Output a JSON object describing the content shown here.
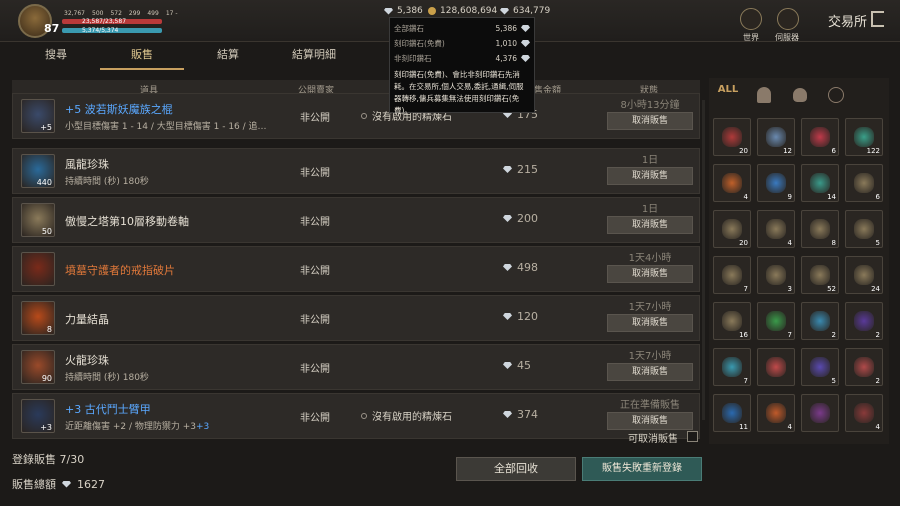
{
  "player": {
    "level": "87",
    "stat_a": "32,767",
    "stat_b": "500",
    "stat_c": "572",
    "stat_d": "299",
    "stat_e": "499",
    "stat_f": "17 -",
    "hp": "23,587/23,587",
    "mp": "5,374/5,374"
  },
  "currency": {
    "gem_free": "5,386",
    "gold": "128,608,694",
    "gem_total": "634,779"
  },
  "nav": {
    "world": "世界",
    "server": "伺服器",
    "title": "交易所"
  },
  "tabs": [
    "搜尋",
    "販售",
    "結算",
    "結算明細"
  ],
  "table": {
    "headers": {
      "item": "道具",
      "public": "公開賣家",
      "price": "售金額",
      "status": "狀態"
    }
  },
  "tooltip": {
    "rows": [
      {
        "label": "全部鑽石",
        "value": "5,386"
      },
      {
        "label": "刻印鑽石(免費)",
        "value": "1,010"
      },
      {
        "label": "非刻印鑽石",
        "value": "4,376"
      }
    ],
    "desc": "刻印鑽石(免費)、會比非刻印鑽石先消耗。在交易所,個人交易,委託,通緝,伺服器轉移,傭兵募集無法使用刻印鑽石(免費)。"
  },
  "rows": [
    {
      "name": "+5 波若斯妖魔族之棍",
      "name_class": "blue",
      "sub": "小型目標傷害 1 - 14 / 大型目標傷害 1 - 16 / 追…",
      "qty": "+5",
      "public": "非公開",
      "refine": "沒有啟用的精煉石",
      "price": "175",
      "status": "8小時13分鐘",
      "cancel": "取消販售",
      "icon_color": "#3a4a6a"
    },
    {
      "name": "風龍珍珠",
      "name_class": "",
      "sub": "持續時間 (秒) 180秒",
      "qty": "440",
      "public": "非公開",
      "refine": "",
      "price": "215",
      "status": "1日",
      "cancel": "取消販售",
      "icon_color": "#2a6a9a"
    },
    {
      "name": "傲慢之塔第10層移動卷軸",
      "name_class": "",
      "sub": "",
      "qty": "50",
      "public": "非公開",
      "refine": "",
      "price": "200",
      "status": "1日",
      "cancel": "取消販售",
      "icon_color": "#8a7a5a"
    },
    {
      "name": "墳墓守護者的戒指破片",
      "name_class": "orange",
      "sub": "",
      "qty": "",
      "public": "非公開",
      "refine": "",
      "price": "498",
      "status": "1天4小時",
      "cancel": "取消販售",
      "icon_color": "#7a2a1a"
    },
    {
      "name": "力量結晶",
      "name_class": "",
      "sub": "",
      "qty": "8",
      "public": "非公開",
      "refine": "",
      "price": "120",
      "status": "1天7小時",
      "cancel": "取消販售",
      "icon_color": "#b84a1a"
    },
    {
      "name": "火龍珍珠",
      "name_class": "",
      "sub": "持續時間 (秒) 180秒",
      "qty": "90",
      "public": "非公開",
      "refine": "",
      "price": "45",
      "status": "1天7小時",
      "cancel": "取消販售",
      "icon_color": "#9a4a2a"
    },
    {
      "name": "+3 古代鬥士臂甲",
      "name_class": "blue",
      "sub_a": "近距離傷害 +2 / 物理防禦力 +3",
      "sub_b": "+3",
      "qty": "+3",
      "public": "非公開",
      "refine": "沒有啟用的精煉石",
      "price": "374",
      "status": "正在準備販售",
      "cancel": "取消販售",
      "icon_color": "#2a3a5a"
    }
  ],
  "inventory": {
    "tabs": [
      "ALL",
      "helmet-icon",
      "bag-icon",
      "ancient-icon"
    ],
    "slots": [
      {
        "q": "20",
        "c": "#b03a3a"
      },
      {
        "q": "12",
        "c": "#6a8ab0"
      },
      {
        "q": "6",
        "c": "#c03a4a"
      },
      {
        "q": "122",
        "c": "#3aa08a"
      },
      {
        "q": "4",
        "c": "#c0602a"
      },
      {
        "q": "9",
        "c": "#3a7ac0"
      },
      {
        "q": "14",
        "c": "#3a9a8a"
      },
      {
        "q": "6",
        "c": "#8a7a5a"
      },
      {
        "q": "20",
        "c": "#8a7a5a"
      },
      {
        "q": "4",
        "c": "#8a7a5a"
      },
      {
        "q": "8",
        "c": "#8a7a5a"
      },
      {
        "q": "5",
        "c": "#8a7a5a"
      },
      {
        "q": "7",
        "c": "#8a7a5a"
      },
      {
        "q": "3",
        "c": "#8a7a5a"
      },
      {
        "q": "52",
        "c": "#8a7a5a"
      },
      {
        "q": "24",
        "c": "#8a7a5a"
      },
      {
        "q": "16",
        "c": "#8a7a5a"
      },
      {
        "q": "7",
        "c": "#3a9a4a"
      },
      {
        "q": "2",
        "c": "#3a8ab0"
      },
      {
        "q": "2",
        "c": "#5a3a9a"
      },
      {
        "q": "7",
        "c": "#3a9ab0"
      },
      {
        "q": "",
        "c": "#c04a4a"
      },
      {
        "q": "5",
        "c": "#5a4ab0"
      },
      {
        "q": "2",
        "c": "#b04a4a"
      },
      {
        "q": "11",
        "c": "#2a6ab0"
      },
      {
        "q": "4",
        "c": "#c05a2a"
      },
      {
        "q": "",
        "c": "#7a3a8a"
      },
      {
        "q": "4",
        "c": "#8a3a3a"
      }
    ]
  },
  "bottom": {
    "listed_label": "登錄販售 7/30",
    "total_label": "販售總額",
    "total_value": "1627",
    "cancelable": "可取消販售",
    "collect": "全部回收",
    "relist": "販售失敗重新登錄"
  }
}
